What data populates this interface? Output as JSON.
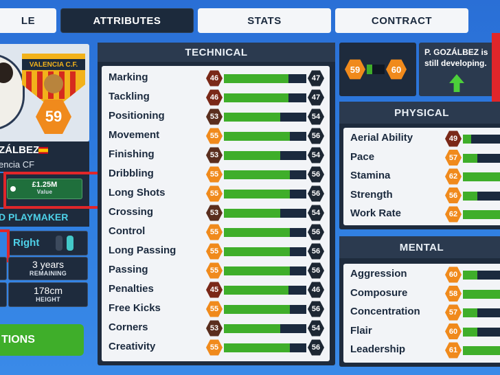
{
  "tabs": [
    {
      "label": "LE",
      "active": false
    },
    {
      "label": "ATTRIBUTES",
      "active": true
    },
    {
      "label": "STATS",
      "active": false
    },
    {
      "label": "CONTRACT",
      "active": false
    }
  ],
  "player": {
    "name": "ZÁLBEZ",
    "club": "encia CF",
    "badge_text": "VALENCIA C.F.",
    "overall": "59",
    "value": "£1.25M",
    "value_label": "Value",
    "role": "D PLAYMAKER",
    "foot": "Right",
    "contract_years": "3 years",
    "contract_label": "REMAINING",
    "height": "178cm",
    "height_label": "HEIGHT",
    "action_label": "TIONS"
  },
  "technical": {
    "title": "TECHNICAL",
    "rows": [
      {
        "name": "Marking",
        "value": 46,
        "max": 47,
        "tone": "red"
      },
      {
        "name": "Tackling",
        "value": 46,
        "max": 47,
        "tone": "red"
      },
      {
        "name": "Positioning",
        "value": 53,
        "max": 54,
        "tone": "dark"
      },
      {
        "name": "Movement",
        "value": 55,
        "max": 56,
        "tone": "orange"
      },
      {
        "name": "Finishing",
        "value": 53,
        "max": 54,
        "tone": "dark"
      },
      {
        "name": "Dribbling",
        "value": 55,
        "max": 56,
        "tone": "orange"
      },
      {
        "name": "Long Shots",
        "value": 55,
        "max": 56,
        "tone": "orange"
      },
      {
        "name": "Crossing",
        "value": 53,
        "max": 54,
        "tone": "dark"
      },
      {
        "name": "Control",
        "value": 55,
        "max": 56,
        "tone": "orange"
      },
      {
        "name": "Long Passing",
        "value": 55,
        "max": 56,
        "tone": "orange"
      },
      {
        "name": "Passing",
        "value": 55,
        "max": 56,
        "tone": "orange"
      },
      {
        "name": "Penalties",
        "value": 45,
        "max": 46,
        "tone": "red"
      },
      {
        "name": "Free Kicks",
        "value": 55,
        "max": 56,
        "tone": "orange"
      },
      {
        "name": "Corners",
        "value": 53,
        "max": 54,
        "tone": "dark"
      },
      {
        "name": "Creativity",
        "value": 55,
        "max": 56,
        "tone": "orange"
      }
    ]
  },
  "development": {
    "current": "59",
    "potential": "60",
    "message": "P. GOZÁLBEZ is still developing."
  },
  "physical": {
    "title": "PHYSICAL",
    "rows": [
      {
        "name": "Aerial Ability",
        "value": 49,
        "tone": "red",
        "fill": 0.2
      },
      {
        "name": "Pace",
        "value": 57,
        "tone": "orange",
        "fill": 0.35
      },
      {
        "name": "Stamina",
        "value": 62,
        "tone": "orange",
        "fill": 0.9
      },
      {
        "name": "Strength",
        "value": 56,
        "tone": "orange",
        "fill": 0.35
      },
      {
        "name": "Work Rate",
        "value": 62,
        "tone": "orange",
        "fill": 0.9
      }
    ]
  },
  "mental": {
    "title": "MENTAL",
    "rows": [
      {
        "name": "Aggression",
        "value": 60,
        "tone": "orange",
        "fill": 0.35
      },
      {
        "name": "Composure",
        "value": 58,
        "tone": "orange",
        "fill": 0.9
      },
      {
        "name": "Concentration",
        "value": 57,
        "tone": "orange",
        "fill": 0.35
      },
      {
        "name": "Flair",
        "value": 60,
        "tone": "orange",
        "fill": 0.35
      },
      {
        "name": "Leadership",
        "value": 61,
        "tone": "orange",
        "fill": 0.9
      }
    ]
  },
  "colors": {
    "accent_green": "#3fae2a",
    "highlight_red": "#e0262a",
    "panel_dark": "#1e2b3d",
    "hex_orange": "#f08a1c"
  }
}
